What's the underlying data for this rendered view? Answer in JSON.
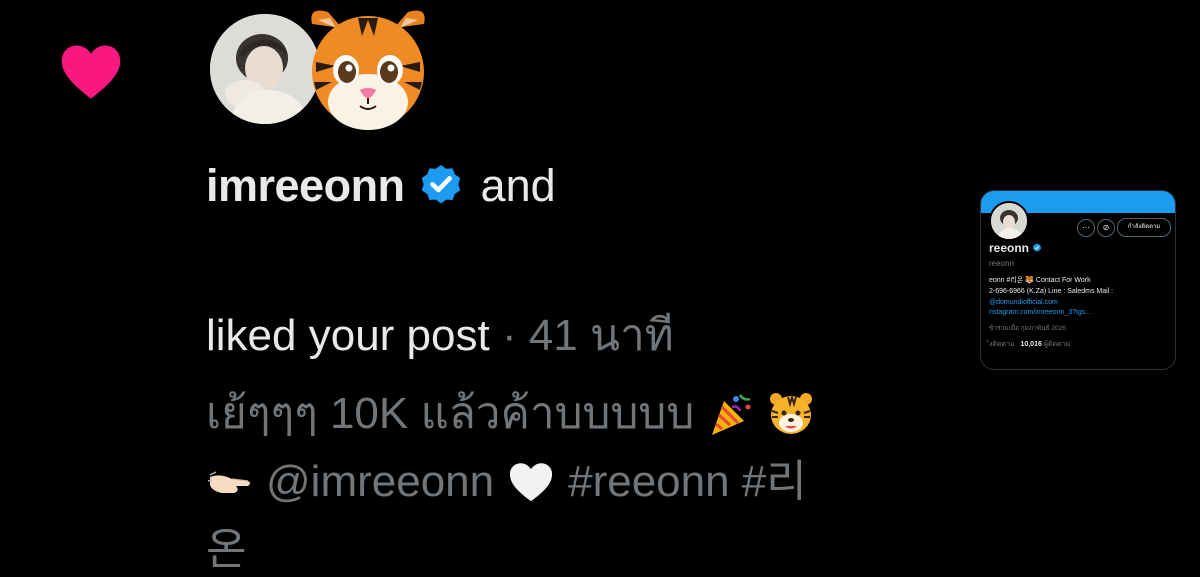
{
  "notification": {
    "username": "imreeonn",
    "conjunction": "and",
    "action": "liked your post",
    "separator": "·",
    "time_ago": "41 นาที",
    "post_lines": [
      "เย้ๆๆๆ 10K แล้วค้าบบบบบ",
      "@imreeonn",
      "#reeonn #리",
      "온"
    ],
    "icons": {
      "like": "heart-icon",
      "verified": "verified-badge-icon",
      "tiger": "tiger-face-icon",
      "party": "party-popper-icon",
      "pointing": "pointing-hand-icon",
      "white_heart": "white-heart-icon"
    }
  },
  "profile_card": {
    "name": "reeonn",
    "handle": "reeonn",
    "bio_line_1": "eonn #리온 🐯 Contact For Work",
    "bio_line_2": "2-696-6966 (K.Za) Line : Saledms Mail :",
    "bio_line_3": "@domundiofficial.com",
    "link": "nstagram.com/imreeonn_3?igs...",
    "joined": "ข้าร่วมเมื่อ กุมภาพันธ์ 2026",
    "following_label": "ังติดตาม",
    "followers_count": "10,016",
    "followers_label": "ผู้ติดตาม",
    "follow_button": "กำลังติดตาม"
  },
  "colors": {
    "background": "#000000",
    "primary_text": "#e7e9ea",
    "secondary_text": "#71767b",
    "like_pink": "#f91880",
    "verified_blue": "#1d9bf0"
  }
}
